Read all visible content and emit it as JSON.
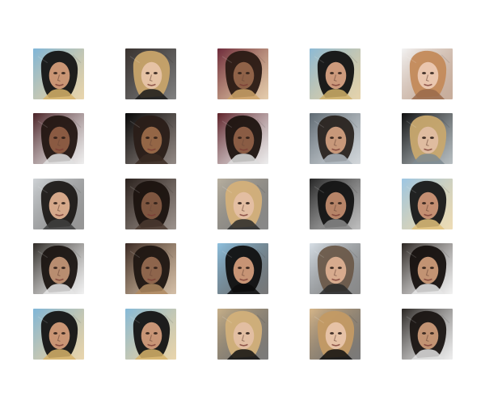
{
  "figure": {
    "rows": 5,
    "cols": 5,
    "tiles": [
      {
        "bg": "#7fb6d9",
        "hair": "#141414",
        "skin": "#c99574",
        "accent": "#d7b36a"
      },
      {
        "bg": "#3a3330",
        "hair": "#c8a46a",
        "skin": "#e5c2a4",
        "accent": "#1a1a1a"
      },
      {
        "bg": "#6d2a3a",
        "hair": "#2a1a14",
        "skin": "#8f6248",
        "accent": "#cfa46a"
      },
      {
        "bg": "#8cbad6",
        "hair": "#121212",
        "skin": "#cc9a7c",
        "accent": "#d0b06a"
      },
      {
        "bg": "#f3f3f3",
        "hair": "#c38a5a",
        "skin": "#eac6ae",
        "accent": "#9a6a4a"
      },
      {
        "bg": "#4a2226",
        "hair": "#231612",
        "skin": "#8a5a42",
        "accent": "#e0e0e0"
      },
      {
        "bg": "#080808",
        "hair": "#2a1d18",
        "skin": "#946646",
        "accent": "#3a2a22"
      },
      {
        "bg": "#5d2128",
        "hair": "#1e1410",
        "skin": "#8a5c44",
        "accent": "#dddddd"
      },
      {
        "bg": "#5f6a72",
        "hair": "#2a2420",
        "skin": "#c7987a",
        "accent": "#aeb6bd"
      },
      {
        "bg": "#0f0f0f",
        "hair": "#c8a86e",
        "skin": "#dfbca0",
        "accent": "#7d8a90"
      },
      {
        "bg": "#cfd3d6",
        "hair": "#1e1a18",
        "skin": "#d5a88a",
        "accent": "#404040"
      },
      {
        "bg": "#2b221e",
        "hair": "#1b130f",
        "skin": "#7e5640",
        "accent": "#4b3a30"
      },
      {
        "bg": "#b8b0a0",
        "hair": "#d4b07a",
        "skin": "#e3bea2",
        "accent": "#2a2a2a"
      },
      {
        "bg": "#262626",
        "hair": "#141414",
        "skin": "#b68468",
        "accent": "#8a8a8a"
      },
      {
        "bg": "#9cc6e4",
        "hair": "#181818",
        "skin": "#c48f72",
        "accent": "#e0c07a"
      },
      {
        "bg": "#2f2b27",
        "hair": "#1b1512",
        "skin": "#b88d70",
        "accent": "#e5e5e5"
      },
      {
        "bg": "#3a2a24",
        "hair": "#1f1612",
        "skin": "#8e654c",
        "accent": "#b08a60"
      },
      {
        "bg": "#8ec0de",
        "hair": "#111111",
        "skin": "#c79475",
        "accent": "#0c0c0c"
      },
      {
        "bg": "#d7dfe6",
        "hair": "#6b5a4a",
        "skin": "#d7ab8e",
        "accent": "#2a2a2a"
      },
      {
        "bg": "#2b2521",
        "hair": "#16110f",
        "skin": "#c29373",
        "accent": "#e6e6e6"
      },
      {
        "bg": "#7fb6d9",
        "hair": "#141414",
        "skin": "#c99574",
        "accent": "#d7b36a"
      },
      {
        "bg": "#85bad9",
        "hair": "#141414",
        "skin": "#c89576",
        "accent": "#d7b36a"
      },
      {
        "bg": "#c7b08a",
        "hair": "#d2b07a",
        "skin": "#e2bea2",
        "accent": "#111111"
      },
      {
        "bg": "#d6b68a",
        "hair": "#c39a64",
        "skin": "#e6c2a6",
        "accent": "#0f0f0f"
      },
      {
        "bg": "#2a2623",
        "hair": "#1a1513",
        "skin": "#c29373",
        "accent": "#e0e0e0"
      }
    ]
  }
}
